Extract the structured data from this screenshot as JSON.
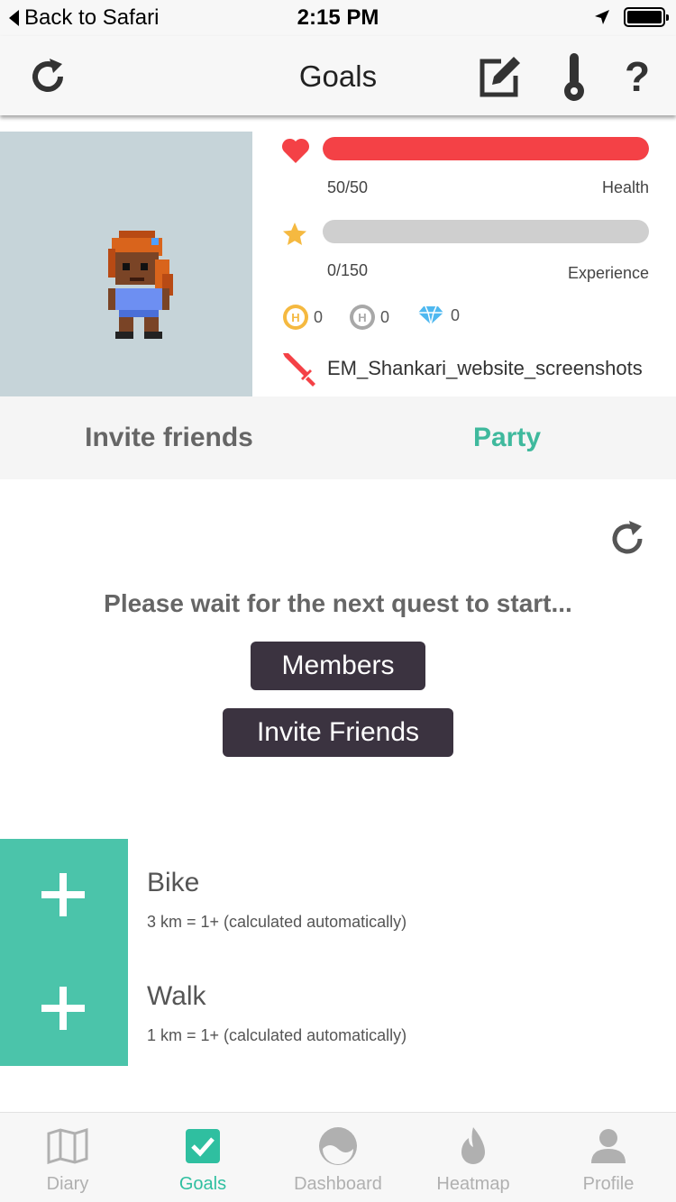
{
  "status_bar": {
    "back_label": "Back to Safari",
    "time": "2:15 PM"
  },
  "nav": {
    "title": "Goals",
    "help_label": "?"
  },
  "stats": {
    "health": {
      "value_text": "50/50",
      "label": "Health",
      "fraction": 1.0,
      "color": "#f44146"
    },
    "experience": {
      "value_text": "0/150",
      "label": "Experience",
      "fraction": 0.0,
      "color": "#f5b940"
    },
    "currencies": [
      {
        "icon": "gold-coin-icon",
        "letter": "H",
        "amount": "0",
        "color": "#f5b940"
      },
      {
        "icon": "silver-coin-icon",
        "letter": "H",
        "amount": "0",
        "color": "#a8a8a8"
      },
      {
        "icon": "gem-icon",
        "amount": "0",
        "color": "#4fb8f0"
      }
    ],
    "party_name": "EM_Shankari_website_screenshots"
  },
  "tabs": [
    {
      "label": "Invite friends",
      "active": false
    },
    {
      "label": "Party",
      "active": true
    }
  ],
  "party": {
    "wait_text": "Please wait for the next quest to start...",
    "members_button": "Members",
    "invite_button": "Invite Friends"
  },
  "activities": [
    {
      "name": "Bike",
      "description": "3 km = 1+ (calculated automatically)"
    },
    {
      "name": "Walk",
      "description": "1 km = 1+ (calculated automatically)"
    }
  ],
  "tab_bar": [
    {
      "label": "Diary",
      "icon": "map-icon",
      "active": false
    },
    {
      "label": "Goals",
      "icon": "checkbox-icon",
      "active": true
    },
    {
      "label": "Dashboard",
      "icon": "dashboard-icon",
      "active": false
    },
    {
      "label": "Heatmap",
      "icon": "flame-icon",
      "active": false
    },
    {
      "label": "Profile",
      "icon": "person-icon",
      "active": false
    }
  ],
  "colors": {
    "accent": "#3fb99d",
    "plus_tile": "#4bc4aa",
    "dark_button": "#3b3340"
  }
}
